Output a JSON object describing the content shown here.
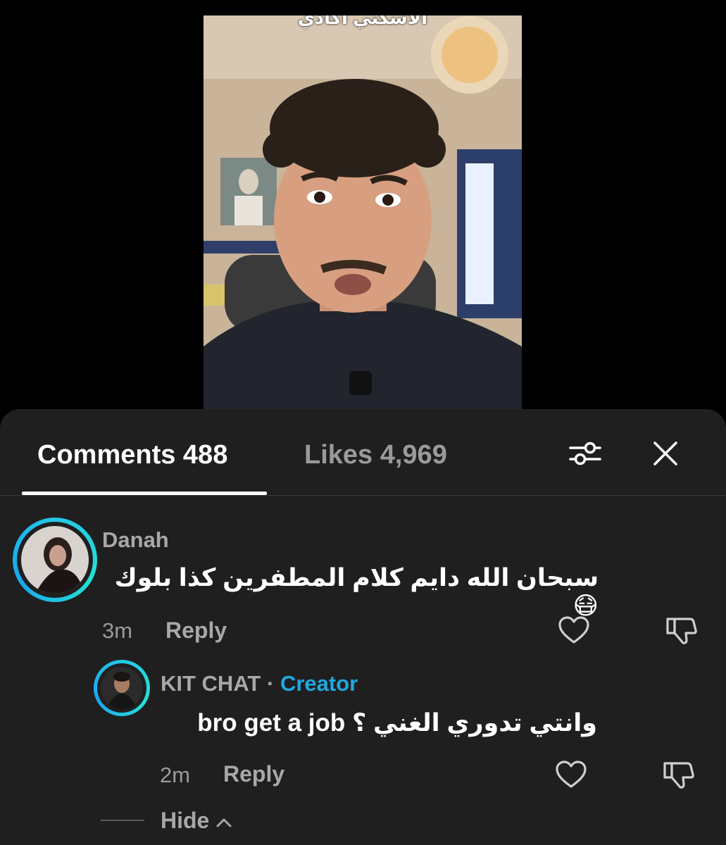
{
  "video": {
    "caption": "الاسكتي اكادي"
  },
  "tabs": {
    "comments_label": "Comments 488",
    "likes_label": "Likes 4,969"
  },
  "comments": [
    {
      "username": "Danah",
      "text": "سبحان الله دايم كلام المطفرين كذا بلوك 😷",
      "time": "3m",
      "reply_label": "Reply"
    }
  ],
  "replies": [
    {
      "username": "KIT CHAT",
      "separator": "·",
      "badge": "Creator",
      "text": "وانتي تدوري الغني ؟ bro get a job",
      "time": "2m",
      "reply_label": "Reply"
    }
  ],
  "hide_label": "Hide",
  "colors": {
    "sheet_bg": "#1f1f1f",
    "creator_badge": "#1fa8e0",
    "story_ring": "#23c7e6"
  },
  "icons": {
    "filter": "sliders-icon",
    "close": "close-icon",
    "like": "heart-icon",
    "dislike": "thumbs-down-icon",
    "collapse": "chevron-up-icon"
  }
}
